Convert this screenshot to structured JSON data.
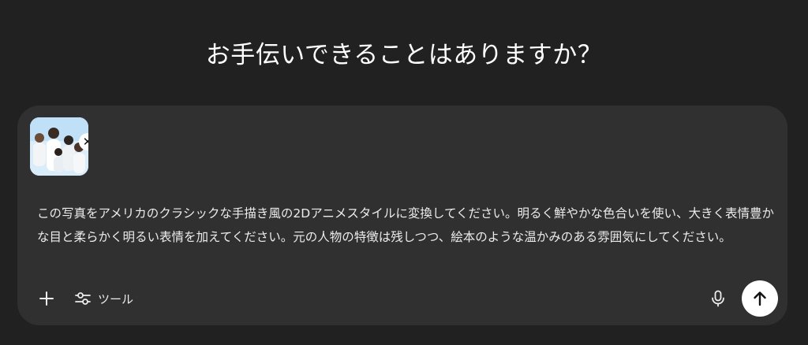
{
  "header": {
    "title": "お手伝いできることはありますか？"
  },
  "composer": {
    "attachment": {
      "kind": "image",
      "remove_label": "✕"
    },
    "prompt": "この写真をアメリカのクラシックな手描き風の2Dアニメスタイルに変換してください。明るく鮮やかな色合いを使い、大きく表情豊かな目と柔らかく明るい表情を加えてください。元の人物の特徴は残しつつ、絵本のような温かみのある雰囲気にしてください。",
    "toolbar": {
      "add_icon": "plus-icon",
      "tools_icon": "sliders-icon",
      "tools_label": "ツール",
      "mic_icon": "microphone-icon",
      "send_icon": "arrow-up-icon"
    }
  },
  "colors": {
    "background": "#212121",
    "composer_bg": "#303030",
    "text": "#ececec",
    "send_bg": "#ffffff"
  }
}
